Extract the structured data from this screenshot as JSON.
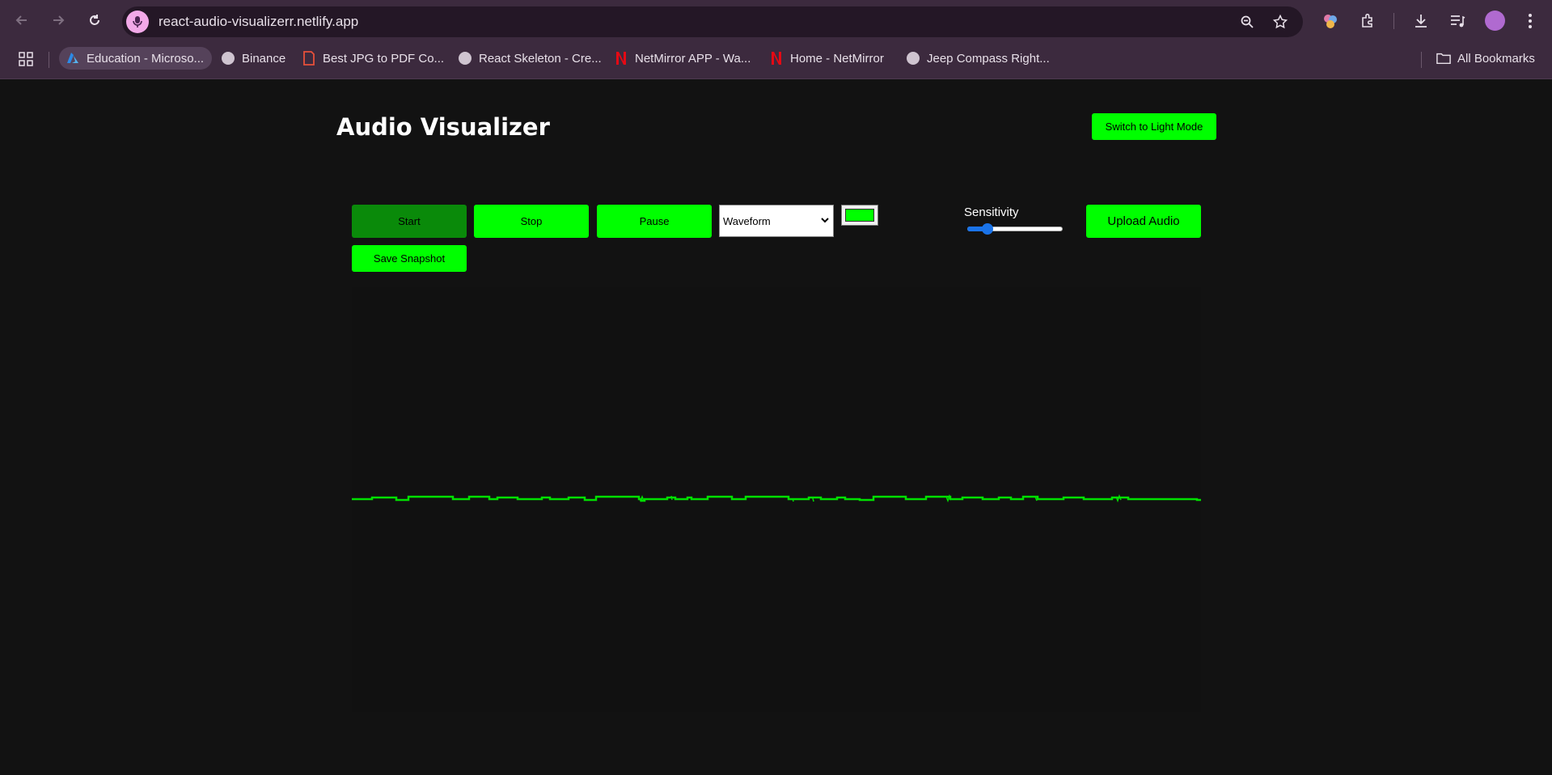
{
  "browser": {
    "url": "react-audio-visualizerr.netlify.app",
    "bookmarks": [
      {
        "label": "Education - Microso...",
        "icon": "azure-icon"
      },
      {
        "label": "Binance",
        "icon": "globe-icon"
      },
      {
        "label": "Best JPG to PDF Co...",
        "icon": "pdf-icon"
      },
      {
        "label": "React Skeleton - Cre...",
        "icon": "globe-icon"
      },
      {
        "label": "NetMirror APP - Wa...",
        "icon": "netmirror-icon"
      },
      {
        "label": "Home - NetMirror",
        "icon": "netmirror-icon"
      },
      {
        "label": "Jeep Compass Right...",
        "icon": "globe-icon"
      }
    ],
    "all_bookmarks_label": "All Bookmarks"
  },
  "app": {
    "title": "Audio Visualizer",
    "theme_toggle_label": "Switch to Light Mode",
    "controls": {
      "start_label": "Start",
      "stop_label": "Stop",
      "pause_label": "Pause",
      "mode_selected": "Waveform",
      "color_value": "#00ff00",
      "sensitivity_label": "Sensitivity",
      "sensitivity_value": 0.2,
      "upload_label": "Upload Audio",
      "snapshot_label": "Save Snapshot"
    },
    "colors": {
      "accent": "#00ff00",
      "active_button": "#0a8a0a",
      "background": "#121212"
    }
  }
}
